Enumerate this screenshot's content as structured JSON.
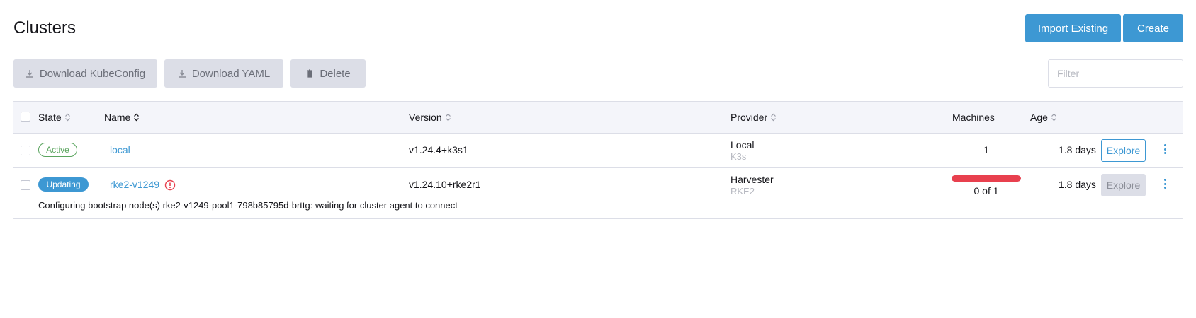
{
  "page": {
    "title": "Clusters"
  },
  "actions": {
    "import_label": "Import Existing",
    "create_label": "Create"
  },
  "bulk": {
    "download_kubeconfig": "Download KubeConfig",
    "download_yaml": "Download YAML",
    "delete": "Delete"
  },
  "filter": {
    "placeholder": "Filter"
  },
  "table": {
    "headers": {
      "state": "State",
      "name": "Name",
      "version": "Version",
      "provider": "Provider",
      "machines": "Machines",
      "age": "Age"
    },
    "rows": [
      {
        "state": "Active",
        "name": "local",
        "version": "v1.24.4+k3s1",
        "provider": "Local",
        "provider_sub": "K3s",
        "machines": "1",
        "age": "1.8 days",
        "explore": "Explore"
      },
      {
        "state": "Updating",
        "name": "rke2-v1249",
        "version": "v1.24.10+rke2r1",
        "provider": "Harvester",
        "provider_sub": "RKE2",
        "machines": "0 of 1",
        "machines_ready_fraction": 0,
        "age": "1.8 days",
        "explore": "Explore",
        "message": "Configuring bootstrap node(s) rke2-v1249-pool1-798b85795d-brttg: waiting for cluster agent to connect"
      }
    ]
  },
  "colors": {
    "accent": "#3d98d3",
    "success": "#5ba55f",
    "error": "#e8404e",
    "muted": "#dcdee7"
  }
}
